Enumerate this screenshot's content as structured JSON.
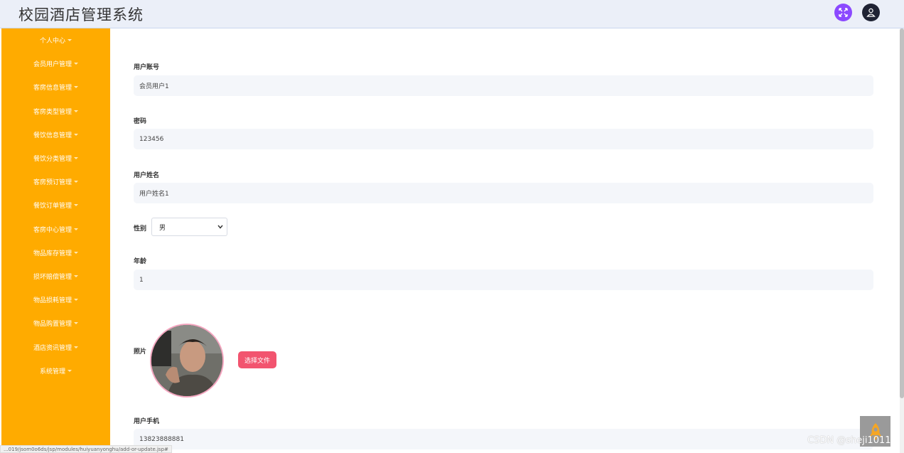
{
  "header": {
    "title": "校园酒店管理系统"
  },
  "sidebar": {
    "items": [
      {
        "label": "个人中心"
      },
      {
        "label": "会员用户管理"
      },
      {
        "label": "客房信息管理"
      },
      {
        "label": "客房类型管理"
      },
      {
        "label": "餐饮信息管理"
      },
      {
        "label": "餐饮分类管理"
      },
      {
        "label": "客房预订管理"
      },
      {
        "label": "餐饮订单管理"
      },
      {
        "label": "客房中心管理"
      },
      {
        "label": "物品库存管理"
      },
      {
        "label": "损坏赔偿管理"
      },
      {
        "label": "物品损耗管理"
      },
      {
        "label": "物品购置管理"
      },
      {
        "label": "酒店资讯管理"
      },
      {
        "label": "系统管理"
      }
    ]
  },
  "form": {
    "account_label": "用户账号",
    "account_value": "会员用户1",
    "password_label": "密码",
    "password_value": "123456",
    "name_label": "用户姓名",
    "name_value": "用户姓名1",
    "gender_label": "性别",
    "gender_value": "男",
    "age_label": "年龄",
    "age_value": "1",
    "photo_label": "照片",
    "choose_file_label": "选择文件",
    "phone_label": "用户手机",
    "phone_value": "13823888881"
  },
  "statusbar": {
    "url": "...019/jsom0o6ds/jsp/modules/huiyuanyonghu/add-or-update.jsp#"
  },
  "watermark": "CSDN @sheji1011",
  "colors": {
    "sidebar": "#ffab00",
    "header": "#ebeff8",
    "primary_button": "#f2546f",
    "expand_icon_bg": "#8b49ff"
  }
}
